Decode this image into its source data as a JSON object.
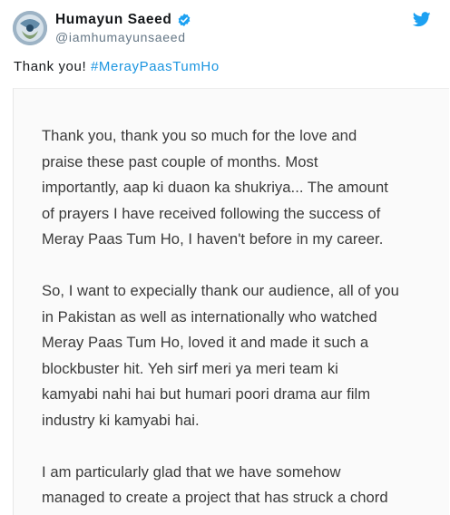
{
  "user": {
    "name": "Humayun Saeed",
    "handle": "@iamhumayunsaeed"
  },
  "tweet": {
    "text": "Thank you! ",
    "hashtag": "#MerayPaasTumHo"
  },
  "letter": {
    "paragraphs": [
      "Thank you, thank you so much for the love and\npraise these past couple of months. Most\nimportantly, aap ki duaon ka shukriya... The amount\nof prayers I have received following the success of\nMeray Paas Tum Ho, I haven't before in my career.",
      "So, I want to expecially thank our audience, all of you\nin Pakistan as well as internationally who watched\nMeray Paas Tum Ho, loved it and made it such a\nblockbuster hit. Yeh sirf meri ya meri team ki\nkamyabi nahi hai but humari poori drama aur film\nindustry ki kamyabi hai.",
      "I am particularly glad that we have somehow\nmanaged to create a project that has struck a chord"
    ]
  },
  "colors": {
    "verified": "#1da1f2",
    "twitter_brand": "#1da1f2",
    "hashtag": "#1b95e0"
  },
  "icons": [
    "verified-badge-icon",
    "twitter-bird-icon"
  ]
}
